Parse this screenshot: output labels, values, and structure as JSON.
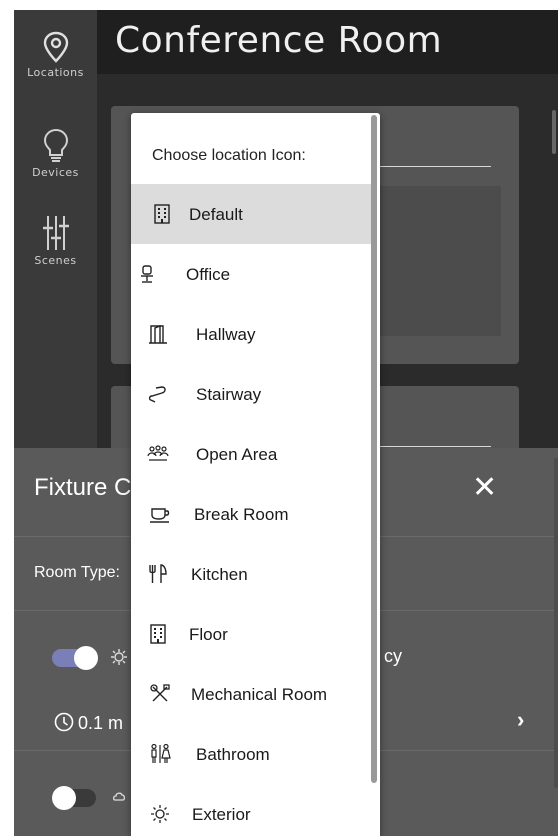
{
  "nav": {
    "items": [
      {
        "label": "Locations",
        "icon": "location-pin-icon"
      },
      {
        "label": "Devices",
        "icon": "lightbulb-icon"
      },
      {
        "label": "Scenes",
        "icon": "sliders-icon"
      }
    ]
  },
  "header": {
    "title": "Conference Room"
  },
  "sheet": {
    "title": "Fixture C",
    "close_glyph": "✕",
    "room_type_label": "Room Type:",
    "row1_suffix": "cy",
    "row2_time": "0.1 m",
    "chevron_glyph": "›"
  },
  "menu": {
    "title": "Choose location Icon:",
    "items": [
      {
        "label": "Default",
        "icon": "building-icon",
        "selected": true
      },
      {
        "label": "Office",
        "icon": "office-chair-icon"
      },
      {
        "label": "Hallway",
        "icon": "hallway-door-icon"
      },
      {
        "label": "Stairway",
        "icon": "stairway-icon"
      },
      {
        "label": "Open Area",
        "icon": "people-group-icon"
      },
      {
        "label": "Break Room",
        "icon": "coffee-cup-icon"
      },
      {
        "label": "Kitchen",
        "icon": "utensils-icon"
      },
      {
        "label": "Floor",
        "icon": "floor-building-icon"
      },
      {
        "label": "Mechanical Room",
        "icon": "tools-icon"
      },
      {
        "label": "Bathroom",
        "icon": "restroom-icon"
      },
      {
        "label": "Exterior",
        "icon": "sun-gear-icon"
      }
    ]
  },
  "colors": {
    "toggle_on": "#7b7fb8",
    "toggle_off": "#3a3a3a",
    "selected_bg": "#dcdcdc"
  }
}
